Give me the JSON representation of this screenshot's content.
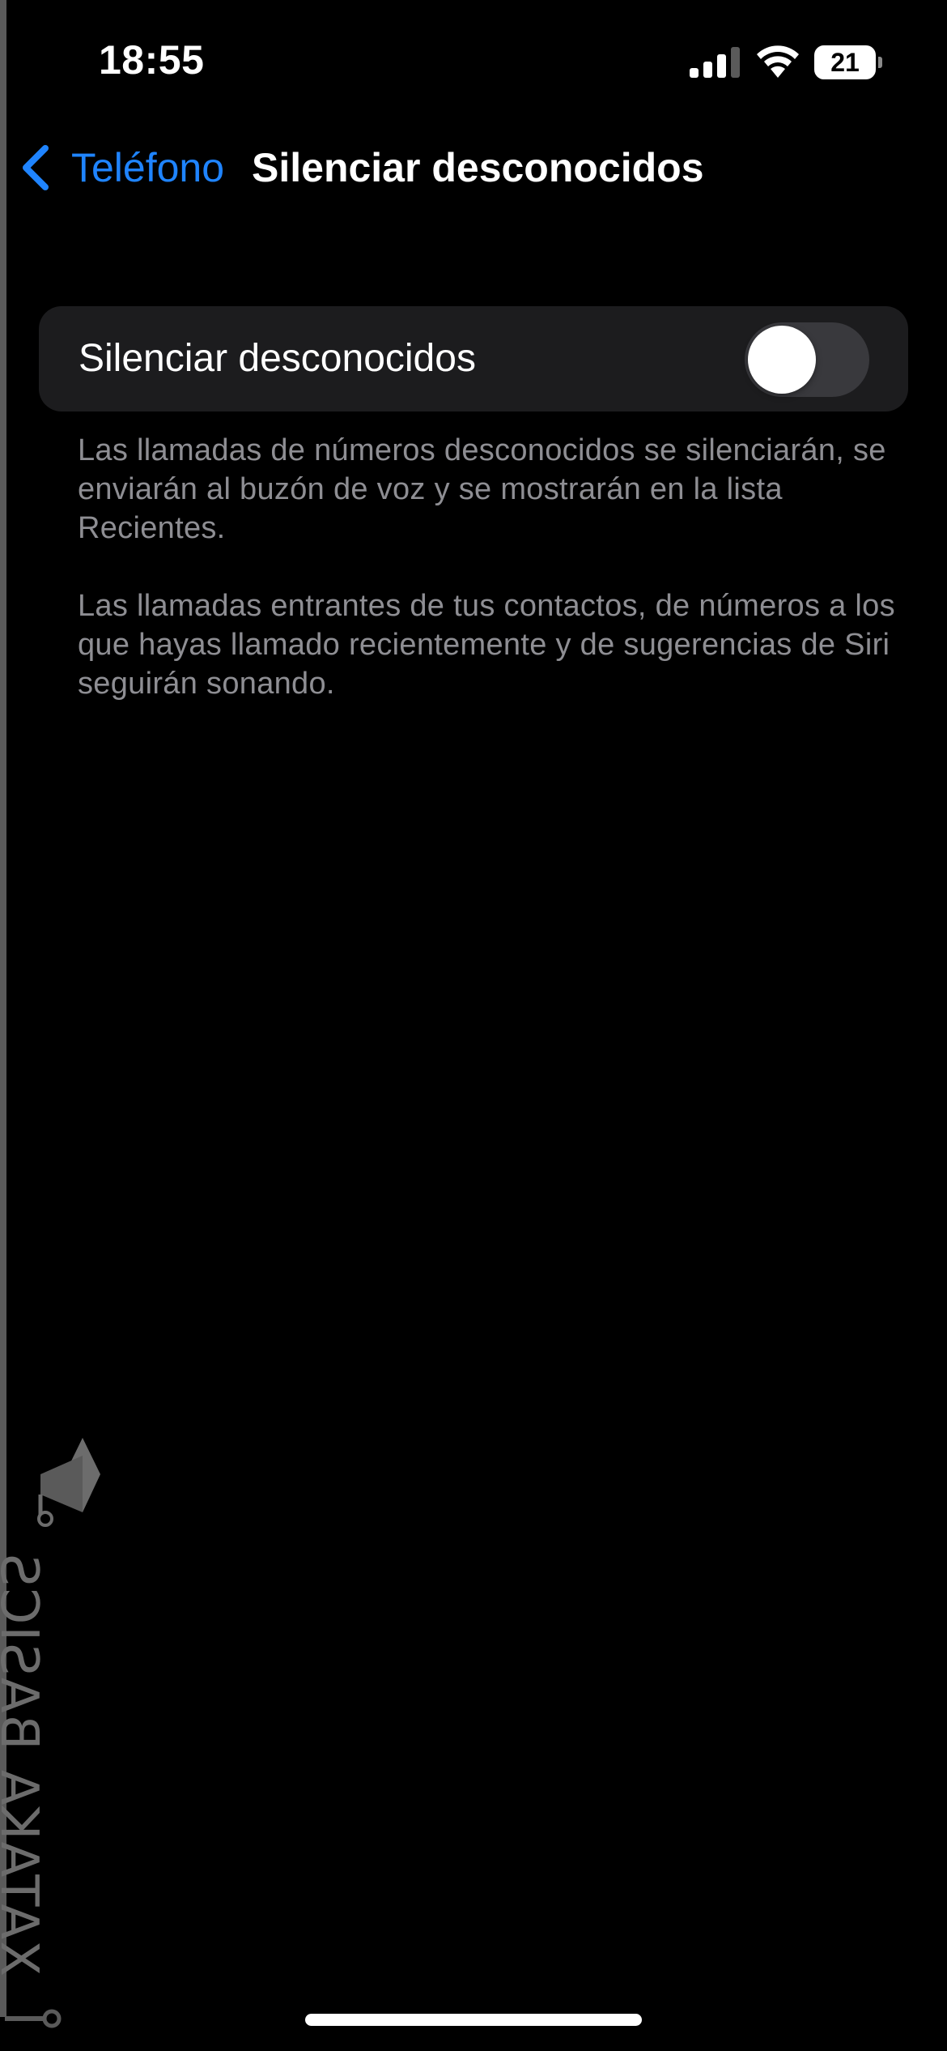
{
  "status_bar": {
    "time": "18:55",
    "battery_level": "21",
    "icons": [
      "signal-icon",
      "wifi-icon",
      "battery-icon"
    ]
  },
  "nav": {
    "back_label": "Teléfono",
    "title": "Silenciar desconocidos"
  },
  "settings": {
    "toggle_row": {
      "label": "Silenciar desconocidos",
      "enabled": false
    },
    "footer_paragraphs": [
      "Las llamadas de números desconocidos se silenciarán, se enviarán al buzón de voz y se mostrarán en la lista Recientes.",
      "Las llamadas entrantes de tus contactos, de números a los que hayas llamado recientemente y de sugerencias de Siri seguirán sonando."
    ]
  },
  "watermark": {
    "text": "XATAKA BASICS"
  },
  "colors": {
    "background": "#000000",
    "accent": "#1f84ff",
    "group_background": "#1c1c1e",
    "secondary_text": "#8e8e93",
    "toggle_off": "#39393d"
  }
}
